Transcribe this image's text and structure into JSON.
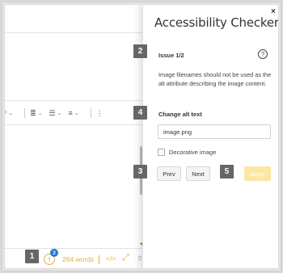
{
  "editor": {
    "toolbar": {
      "items": [
        {
          "icon": "chevron-icon",
          "glyph": "⌄"
        },
        {
          "icon": "line-spacing-icon",
          "glyph": "≣"
        },
        {
          "icon": "bullet-list-icon",
          "glyph": "☰"
        },
        {
          "icon": "numbered-list-icon",
          "glyph": "≡"
        },
        {
          "icon": "more-vertical-icon",
          "glyph": "⋮"
        }
      ]
    },
    "statusbar": {
      "accessibility_icon": "!",
      "issue_badge": "2",
      "word_count": "264 words",
      "code_glyph": "</>",
      "fullscreen_glyph": "⤢",
      "grip_glyph": "⠿"
    }
  },
  "panel": {
    "title": "Accessibility Checker",
    "close_glyph": "×",
    "issue_label": "Issue 1/2",
    "help_glyph": "?",
    "description": "Image filenames should not be used as the alt attribute describing the image content.",
    "alt_label": "Change alt text",
    "alt_value": "image.png",
    "decorative_label": "Decorative image",
    "prev_label": "Prev",
    "next_label": "Next",
    "apply_label": "Apply"
  },
  "markers": [
    "1",
    "2",
    "3",
    "4",
    "5"
  ],
  "colors": {
    "accent_yellow": "#e0b13a",
    "apply_disabled": "#fbe7a4",
    "badge_blue": "#2477d3",
    "marker_gray": "#666666"
  }
}
